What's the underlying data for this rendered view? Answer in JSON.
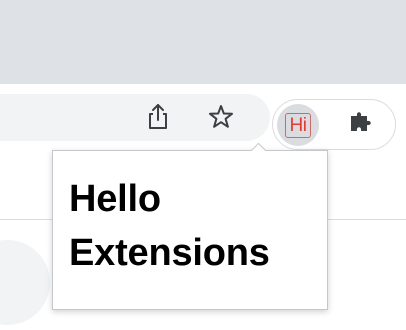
{
  "toolbar": {
    "share_icon": "share-icon",
    "bookmark_icon": "star-icon",
    "extension_icon_text": "Hi",
    "extensions_icon": "puzzle-icon"
  },
  "popup": {
    "heading": "Hello Extensions"
  },
  "colors": {
    "tabstrip": "#dee1e6",
    "omnibox": "#f1f3f4",
    "extension_active_bg": "#dadce0",
    "hi_text": "#e33b34",
    "icon": "#3c4043"
  }
}
